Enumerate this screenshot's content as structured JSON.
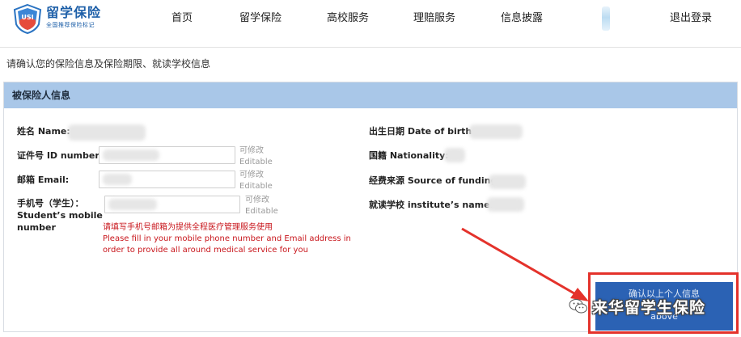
{
  "brand": {
    "title": "留学保险",
    "subtitle": "全国推荐保险标记",
    "badge": "USI",
    "color": "#1d5fa8"
  },
  "nav": {
    "items": [
      {
        "label": "首页"
      },
      {
        "label": "留学保险"
      },
      {
        "label": "高校服务"
      },
      {
        "label": "理赔服务"
      },
      {
        "label": "信息披露"
      }
    ],
    "logout": "退出登录"
  },
  "intro": "请确认您的保险信息及保险期限、就读学校信息",
  "panel": {
    "title": "被保险人信息",
    "header_color": "#a9c7e8"
  },
  "fields": {
    "name_label": "姓名 Name:",
    "id_label": "证件号 ID number:",
    "email_label": "邮箱 Email:",
    "phone_label_1": "手机号（学生）：",
    "phone_label_2": "Student’s mobile",
    "phone_label_3": "number",
    "editable_cn": "可修改",
    "editable_en": "Editable",
    "birth_label": "出生日期 Date of birth:",
    "nationality_label": "国籍 Nationality:",
    "funding_label": "经费来源 Source of funding:",
    "institute_label": "就读学校 institute’s name:"
  },
  "notice": {
    "cn": "请填写手机号邮箱为提供全程医疗管理服务使用",
    "en": "Please fill in your mobile phone number and Email address in order to provide all around medical service for you",
    "color": "#c8151b"
  },
  "confirm": {
    "line1": "确认以上个人信息",
    "line2": "above",
    "color": "#2b62b4",
    "outline_color": "#e4322b"
  },
  "watermark": {
    "text": "来华留学生保险",
    "icon": "wechat-icon"
  }
}
